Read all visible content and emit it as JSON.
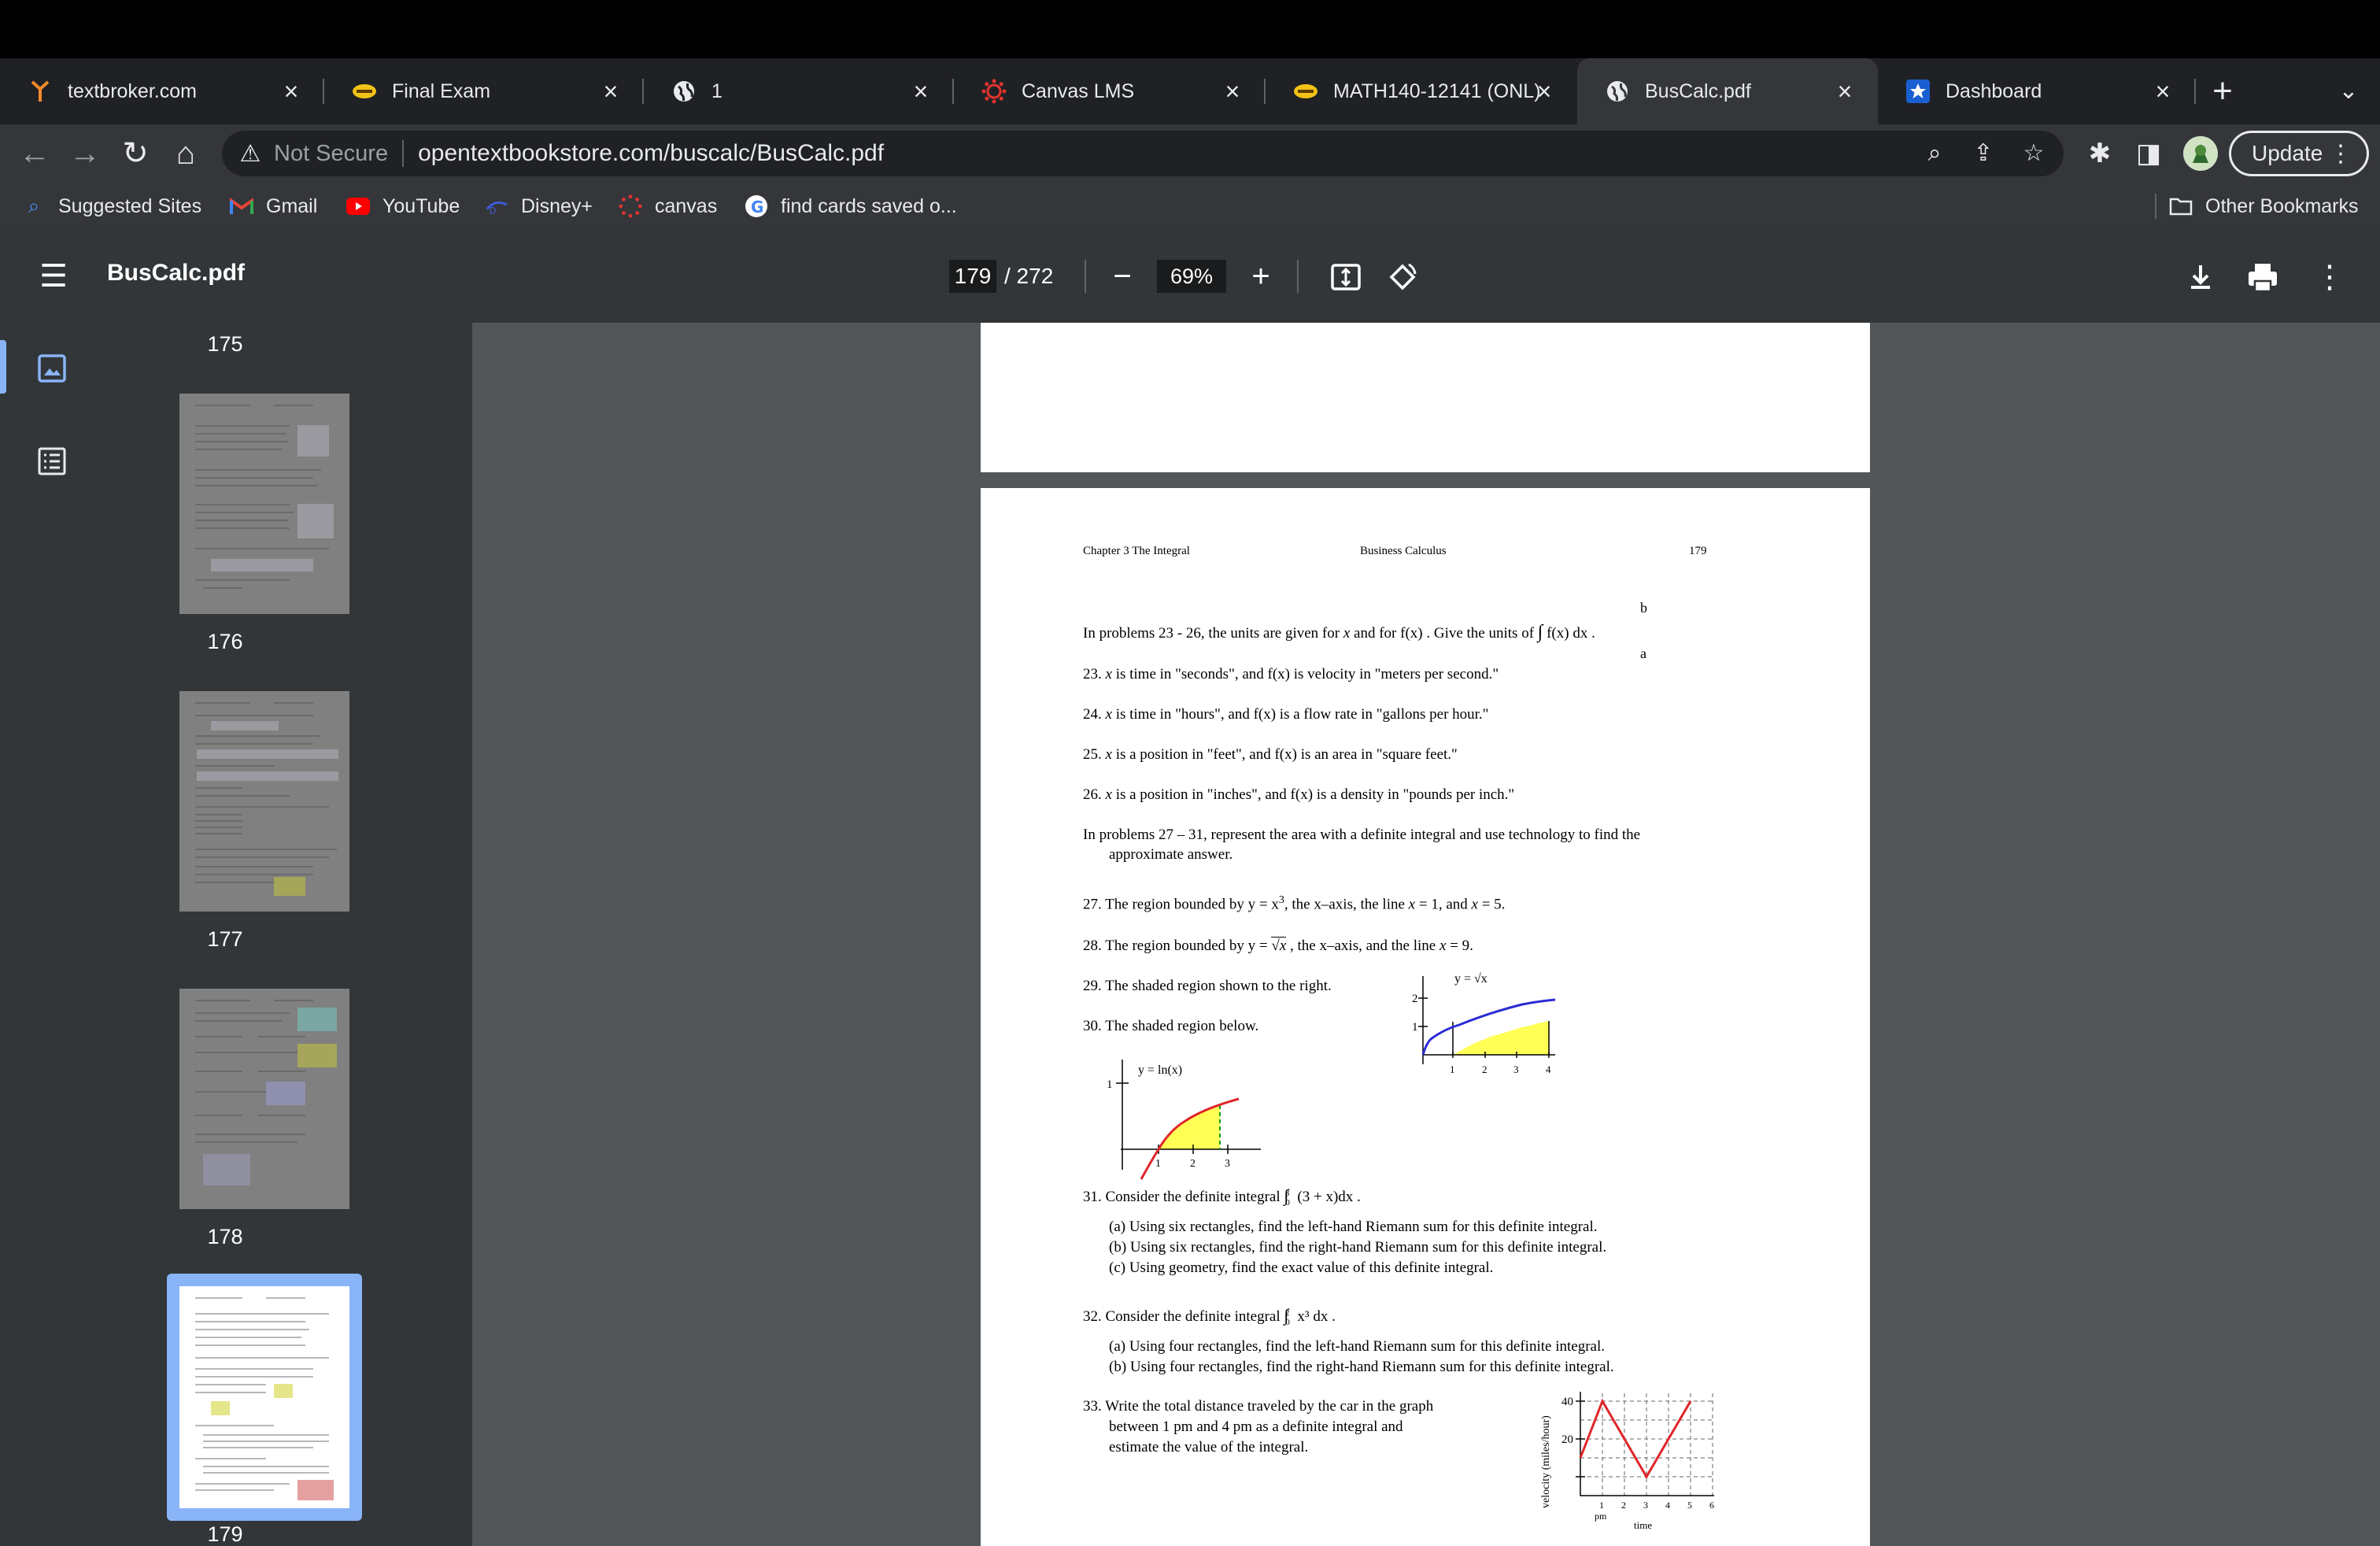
{
  "tabs": [
    {
      "title": "textbroker.com",
      "close": "×",
      "icon": "textbroker-favicon",
      "active": false
    },
    {
      "title": "Final Exam",
      "close": "×",
      "icon": "final-exam-favicon",
      "active": false
    },
    {
      "title": "1",
      "close": "×",
      "icon": "globe-icon",
      "active": false
    },
    {
      "title": "Canvas LMS",
      "close": "×",
      "icon": "canvas-favicon",
      "active": false
    },
    {
      "title": "MATH140-12141 (ONL)",
      "close": "×",
      "icon": "math-favicon",
      "active": false
    },
    {
      "title": "BusCalc.pdf",
      "close": "×",
      "icon": "globe-icon",
      "active": true
    },
    {
      "title": "Dashboard",
      "close": "×",
      "icon": "star-favicon",
      "active": false
    }
  ],
  "omnibox": {
    "security": "Not Secure",
    "url": "opentextbookstore.com/buscalc/BusCalc.pdf"
  },
  "toolbar": {
    "update_label": "Update"
  },
  "bookmarks": [
    {
      "label": "Suggested Sites"
    },
    {
      "label": "Gmail"
    },
    {
      "label": "YouTube"
    },
    {
      "label": "Disney+"
    },
    {
      "label": "canvas"
    },
    {
      "label": "find cards saved o..."
    }
  ],
  "other_bookmarks": "Other Bookmarks",
  "pdf": {
    "title": "BusCalc.pdf",
    "page_current": "179",
    "page_total": "/ 272",
    "zoom": "69%"
  },
  "thumbnails": [
    {
      "label": "175"
    },
    {
      "label": "176"
    },
    {
      "label": "177"
    },
    {
      "label": "178"
    },
    {
      "label": "179"
    }
  ],
  "page": {
    "header_left": "Chapter 3    The Integral",
    "header_center": "Business Calculus",
    "header_right": "179",
    "intro_a": "In problems 23 - 26, the units are given for",
    "intro_x": "x",
    "intro_b": "and for  f(x) .  Give the units of",
    "intro_c": "f(x) dx  .",
    "int_top": "b",
    "int_bot": "a",
    "p23": "23.",
    "p23_x": "x",
    "p23_t": "is time in \"seconds\",  and  f(x)  is velocity in  \"meters per second.\"",
    "p24": "24.",
    "p24_x": "x",
    "p24_t": "is time in \"hours\",  and  f(x)  is a flow rate in  \"gallons per hour.\"",
    "p25": "25.",
    "p25_x": "x",
    "p25_t": "is a position in \"feet\",  and  f(x)  is an area in \"square feet.\"",
    "p26": "26.",
    "p26_x": "x",
    "p26_t": "is a position in \"inches\", and f(x)  is a density in \"pounds per inch.\"",
    "intro2_l1": "In problems 27 – 31, represent the area with a definite integral and use technology to find the",
    "intro2_l2": "approximate answer.",
    "p27_a": "27. The region bounded by  y = x",
    "p27_sup": "3",
    "p27_b": ", the x–axis, the line",
    "p27_x1": "x",
    "p27_c": "= 1, and",
    "p27_x2": "x",
    "p27_d": "= 5.",
    "p28_a": "28. The region bounded by  y =",
    "p28_rad": "x",
    "p28_b": " , the x–axis, and  the line",
    "p28_x": "x",
    "p28_c": "= 9.",
    "p29": "29. The shaded region shown to the right.",
    "p30": "30. The shaded region below.",
    "g29_label": "y = √x",
    "g29_y2": "2",
    "g29_y1": "1",
    "g29_ticks": [
      "1",
      "2",
      "3",
      "4"
    ],
    "g30_label": "y = ln(x)",
    "g30_y1": "1",
    "g30_ticks": [
      "1",
      "2",
      "3"
    ],
    "p31_a": "31. Consider the definite integral",
    "p31_int": "(3 + x)dx .",
    "p31_top": "3",
    "p31_bot": "0",
    "p31_a1": "(a)  Using six rectangles, find the left-hand Riemann sum for this definite integral.",
    "p31_b1": "(b) Using six rectangles, find the right-hand Riemann sum for this definite integral.",
    "p31_c1": "(c)  Using geometry, find the exact value of this definite integral.",
    "p32_a": "32. Consider the definite integral",
    "p32_int": "x³ dx .",
    "p32_top": "2",
    "p32_bot": "0",
    "p32_a1": "(a)  Using four rectangles, find the left-hand Riemann sum for this definite integral.",
    "p32_b1": "(b)  Using four rectangles, find the right-hand Riemann sum for this definite integral.",
    "p33_l1": "33. Write the total distance traveled by the car in the graph",
    "p33_l2": "between 1 pm and 4 pm as a definite integral and",
    "p33_l3": "estimate the value of the integral.",
    "g33_ylabel": "velocity (miles/hour)",
    "g33_y40": "40",
    "g33_y20": "20",
    "g33_ticks": [
      "1",
      "2",
      "3",
      "4",
      "5",
      "6"
    ],
    "g33_pm": "pm",
    "g33_xlabel": "time"
  },
  "colors": {
    "curve_red": "#e0262b",
    "curve_blue": "#2b2bd6",
    "fill_yellow": "#ffff55",
    "accent": "#8ab4f8"
  }
}
